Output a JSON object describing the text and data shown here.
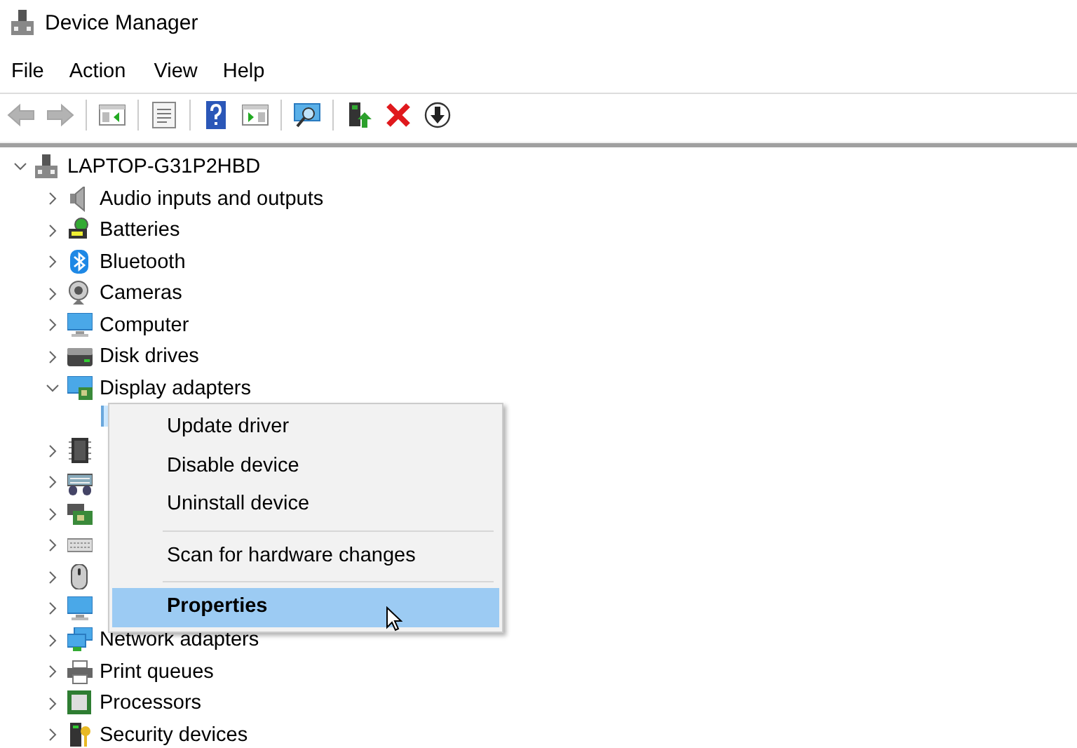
{
  "window": {
    "title": "Device Manager"
  },
  "menu_bar": [
    "File",
    "Action",
    "View",
    "Help"
  ],
  "toolbar": [
    {
      "kind": "back",
      "disabled": true
    },
    {
      "kind": "forward",
      "disabled": true
    },
    {
      "kind": "separator"
    },
    {
      "kind": "console-tree",
      "disabled": false
    },
    {
      "kind": "separator"
    },
    {
      "kind": "properties",
      "disabled": false
    },
    {
      "kind": "separator"
    },
    {
      "kind": "help",
      "disabled": false
    },
    {
      "kind": "action-pane",
      "disabled": false
    },
    {
      "kind": "separator"
    },
    {
      "kind": "scan",
      "disabled": false
    },
    {
      "kind": "separator"
    },
    {
      "kind": "update",
      "disabled": false
    },
    {
      "kind": "uninstall",
      "disabled": false
    },
    {
      "kind": "download",
      "disabled": false
    }
  ],
  "tree": {
    "label": "LAPTOP-G31P2HBD",
    "kind": "computer-root",
    "expanded": true,
    "children": [
      {
        "label": "Audio inputs and outputs",
        "kind": "speaker",
        "expanded": false
      },
      {
        "label": "Batteries",
        "kind": "battery",
        "expanded": false
      },
      {
        "label": "Bluetooth",
        "kind": "bluetooth",
        "expanded": false
      },
      {
        "label": "Cameras",
        "kind": "camera",
        "expanded": false
      },
      {
        "label": "Computer",
        "kind": "monitor",
        "expanded": false
      },
      {
        "label": "Disk drives",
        "kind": "disk",
        "expanded": false
      },
      {
        "label": "Display adapters",
        "kind": "display",
        "expanded": true,
        "children": [
          {
            "selected": true
          }
        ]
      },
      {
        "kind": "chip",
        "expanded": false
      },
      {
        "kind": "hid",
        "expanded": false
      },
      {
        "kind": "card",
        "expanded": false
      },
      {
        "kind": "keyboard",
        "expanded": false
      },
      {
        "kind": "mouse",
        "expanded": false
      },
      {
        "kind": "monitor",
        "expanded": false
      },
      {
        "label": "Network adapters",
        "kind": "network",
        "expanded": false
      },
      {
        "label": "Print queues",
        "kind": "printer",
        "expanded": false
      },
      {
        "label": "Processors",
        "kind": "processor",
        "expanded": false
      },
      {
        "label": "Security devices",
        "kind": "security",
        "expanded": false
      }
    ]
  },
  "context_menu": {
    "groups": [
      [
        {
          "label": "Update driver",
          "selected": false,
          "default": false
        },
        {
          "label": "Disable device",
          "selected": false,
          "default": false
        },
        {
          "label": "Uninstall device",
          "selected": false,
          "default": false
        }
      ],
      [
        {
          "label": "Scan for hardware changes",
          "selected": false,
          "default": false
        }
      ],
      [
        {
          "label": "Properties",
          "selected": true,
          "default": true
        }
      ]
    ]
  }
}
